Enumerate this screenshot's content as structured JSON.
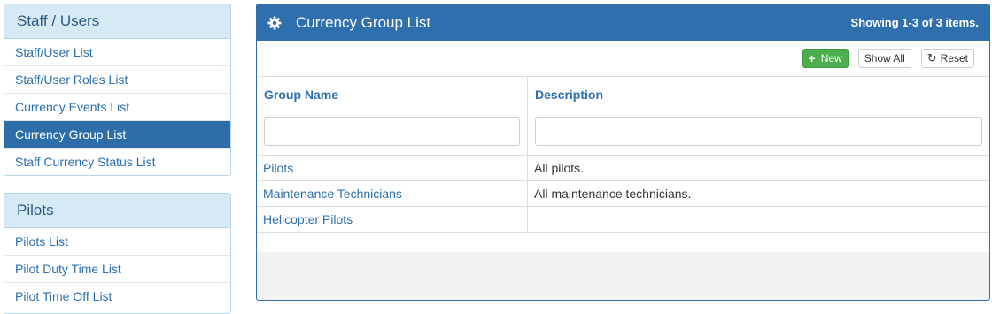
{
  "sidebar": {
    "staff": {
      "title": "Staff / Users",
      "items": [
        {
          "label": "Staff/User List"
        },
        {
          "label": "Staff/User Roles List"
        },
        {
          "label": "Currency Events List"
        },
        {
          "label": "Currency Group List"
        },
        {
          "label": "Staff Currency Status List"
        }
      ]
    },
    "pilots": {
      "title": "Pilots",
      "items": [
        {
          "label": "Pilots List"
        },
        {
          "label": "Pilot Duty Time List"
        },
        {
          "label": "Pilot Time Off List"
        }
      ]
    }
  },
  "main": {
    "title": "Currency Group List",
    "summary": "Showing 1-3 of 3 items.",
    "icon": "gear-icon",
    "toolbar": {
      "new_label": "New",
      "show_all_label": "Show All",
      "reset_label": "Reset"
    },
    "columns": [
      "Group Name",
      "Description"
    ],
    "filters": {
      "name": "",
      "description": ""
    },
    "rows": [
      {
        "name": "Pilots",
        "description": "All pilots."
      },
      {
        "name": "Maintenance Technicians",
        "description": "All maintenance technicians."
      },
      {
        "name": "Helicopter Pilots",
        "description": ""
      }
    ]
  },
  "colors": {
    "primary": "#2f6fae",
    "success": "#4cae4c",
    "sidebar_heading_bg": "#d6eaf6",
    "link": "#2a6fb0"
  }
}
